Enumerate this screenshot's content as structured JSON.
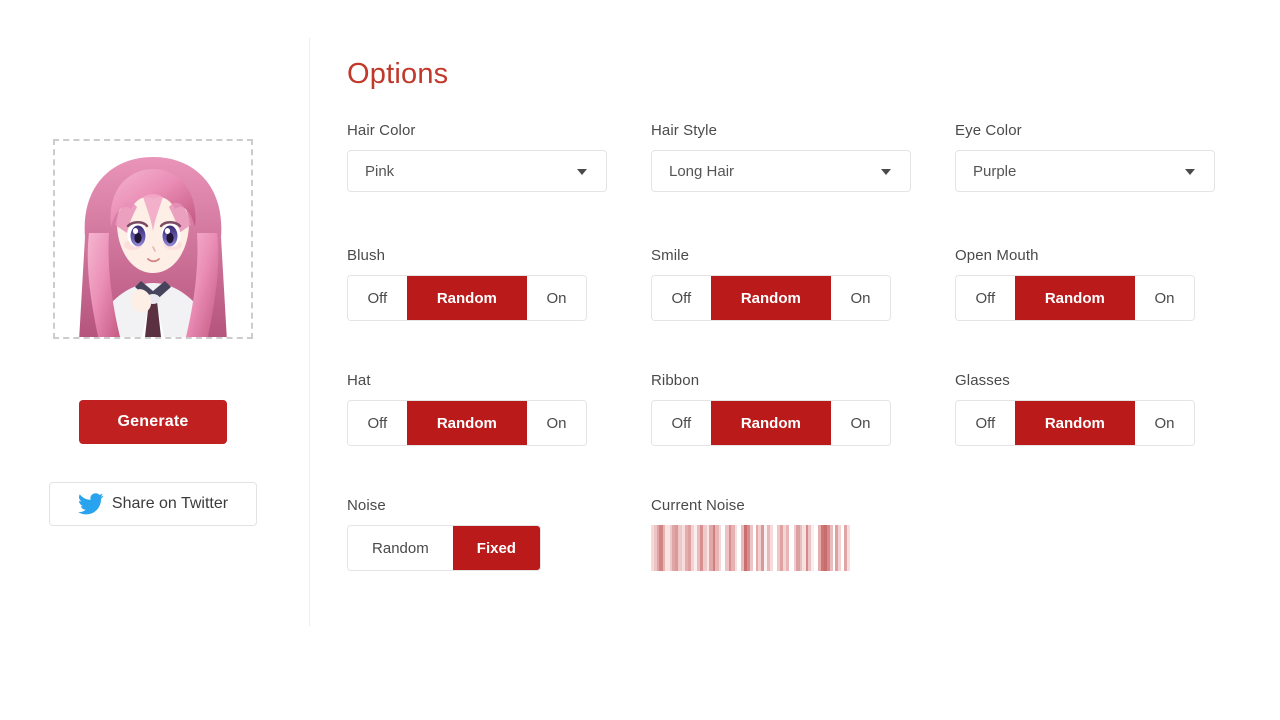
{
  "left": {
    "avatar_alt": "generated anime character portrait",
    "generate_label": "Generate",
    "twitter_label": "Share on Twitter",
    "twitter_icon": "twitter-bird-icon"
  },
  "right": {
    "title": "Options",
    "accent_color": "#c0392b",
    "active_color": "#bb1a1a",
    "selects": [
      {
        "label": "Hair Color",
        "value": "Pink",
        "caret": "chevron-down-icon"
      },
      {
        "label": "Hair Style",
        "value": "Long Hair",
        "caret": "chevron-down-icon"
      },
      {
        "label": "Eye Color",
        "value": "Purple",
        "caret": "chevron-down-icon"
      }
    ],
    "toggles": [
      {
        "label": "Blush",
        "options": [
          "Off",
          "Random",
          "On"
        ],
        "selected": 1
      },
      {
        "label": "Smile",
        "options": [
          "Off",
          "Random",
          "On"
        ],
        "selected": 1
      },
      {
        "label": "Open Mouth",
        "options": [
          "Off",
          "Random",
          "On"
        ],
        "selected": 1
      },
      {
        "label": "Hat",
        "options": [
          "Off",
          "Random",
          "On"
        ],
        "selected": 1
      },
      {
        "label": "Ribbon",
        "options": [
          "Off",
          "Random",
          "On"
        ],
        "selected": 1
      },
      {
        "label": "Glasses",
        "options": [
          "Off",
          "Random",
          "On"
        ],
        "selected": 1
      }
    ],
    "noise": {
      "label": "Noise",
      "options": [
        "Random",
        "Fixed"
      ],
      "selected": 1
    },
    "current_noise": {
      "label": "Current Noise",
      "bars": [
        {
          "w": 3,
          "c": "#f6dada"
        },
        {
          "w": 4,
          "c": "#eec3c3"
        },
        {
          "w": 3,
          "c": "#e3a3a3"
        },
        {
          "w": 4,
          "c": "#d08585"
        },
        {
          "w": 3,
          "c": "#e8b4b4"
        },
        {
          "w": 5,
          "c": "#f8e2e2"
        },
        {
          "w": 3,
          "c": "#eec8c8"
        },
        {
          "w": 4,
          "c": "#e0a5a5"
        },
        {
          "w": 3,
          "c": "#d99a9a"
        },
        {
          "w": 5,
          "c": "#efc9c9"
        },
        {
          "w": 3,
          "c": "#f6dede"
        },
        {
          "w": 4,
          "c": "#e5aeae"
        },
        {
          "w": 3,
          "c": "#dd9f9f"
        },
        {
          "w": 4,
          "c": "#f2d2d2"
        },
        {
          "w": 3,
          "c": "#fbeeee"
        },
        {
          "w": 4,
          "c": "#e9bcbc"
        },
        {
          "w": 3,
          "c": "#d88f8f"
        },
        {
          "w": 5,
          "c": "#efcaca"
        },
        {
          "w": 3,
          "c": "#f9e6e6"
        },
        {
          "w": 4,
          "c": "#e2a8a8"
        },
        {
          "w": 3,
          "c": "#cf8181"
        },
        {
          "w": 4,
          "c": "#e7b7b7"
        },
        {
          "w": 3,
          "c": "#f4d8d8"
        },
        {
          "w": 5,
          "c": "#ffffff"
        },
        {
          "w": 4,
          "c": "#ecc2c2"
        },
        {
          "w": 3,
          "c": "#d98f8f"
        },
        {
          "w": 4,
          "c": "#e6b2b2"
        },
        {
          "w": 3,
          "c": "#f7e0e0"
        },
        {
          "w": 5,
          "c": "#ffffff"
        },
        {
          "w": 3,
          "c": "#e9bbbb"
        },
        {
          "w": 4,
          "c": "#c96f6f"
        },
        {
          "w": 3,
          "c": "#d78d8d"
        },
        {
          "w": 4,
          "c": "#edc5c5"
        },
        {
          "w": 3,
          "c": "#ffffff"
        },
        {
          "w": 3,
          "c": "#e4aaaa"
        },
        {
          "w": 3,
          "c": "#f1d0d0"
        },
        {
          "w": 4,
          "c": "#d99898"
        },
        {
          "w": 3,
          "c": "#fbefef"
        },
        {
          "w": 4,
          "c": "#e8b9b9"
        },
        {
          "w": 3,
          "c": "#f5dbdb"
        },
        {
          "w": 5,
          "c": "#ffffff"
        },
        {
          "w": 4,
          "c": "#eec6c6"
        },
        {
          "w": 3,
          "c": "#dfa2a2"
        },
        {
          "w": 4,
          "c": "#f3d5d5"
        },
        {
          "w": 3,
          "c": "#e7b5b5"
        },
        {
          "w": 6,
          "c": "#ffffff"
        },
        {
          "w": 3,
          "c": "#f0cccc"
        },
        {
          "w": 4,
          "c": "#dba0a0"
        },
        {
          "w": 3,
          "c": "#e9bebe"
        },
        {
          "w": 4,
          "c": "#f7e1e1"
        },
        {
          "w": 3,
          "c": "#d68b8b"
        },
        {
          "w": 4,
          "c": "#edc4c4"
        },
        {
          "w": 3,
          "c": "#fbeded"
        },
        {
          "w": 5,
          "c": "#ffffff"
        },
        {
          "w": 3,
          "c": "#e5adad"
        },
        {
          "w": 4,
          "c": "#cb7575"
        },
        {
          "w": 3,
          "c": "#c86c6c"
        },
        {
          "w": 4,
          "c": "#d58989"
        },
        {
          "w": 3,
          "c": "#e9bdbd"
        },
        {
          "w": 3,
          "c": "#ffffff"
        },
        {
          "w": 4,
          "c": "#dda1a1"
        },
        {
          "w": 3,
          "c": "#f2d3d3"
        },
        {
          "w": 4,
          "c": "#ffffff"
        },
        {
          "w": 3,
          "c": "#e0a6a6"
        },
        {
          "w": 4,
          "c": "#f6dfdf"
        }
      ]
    }
  }
}
